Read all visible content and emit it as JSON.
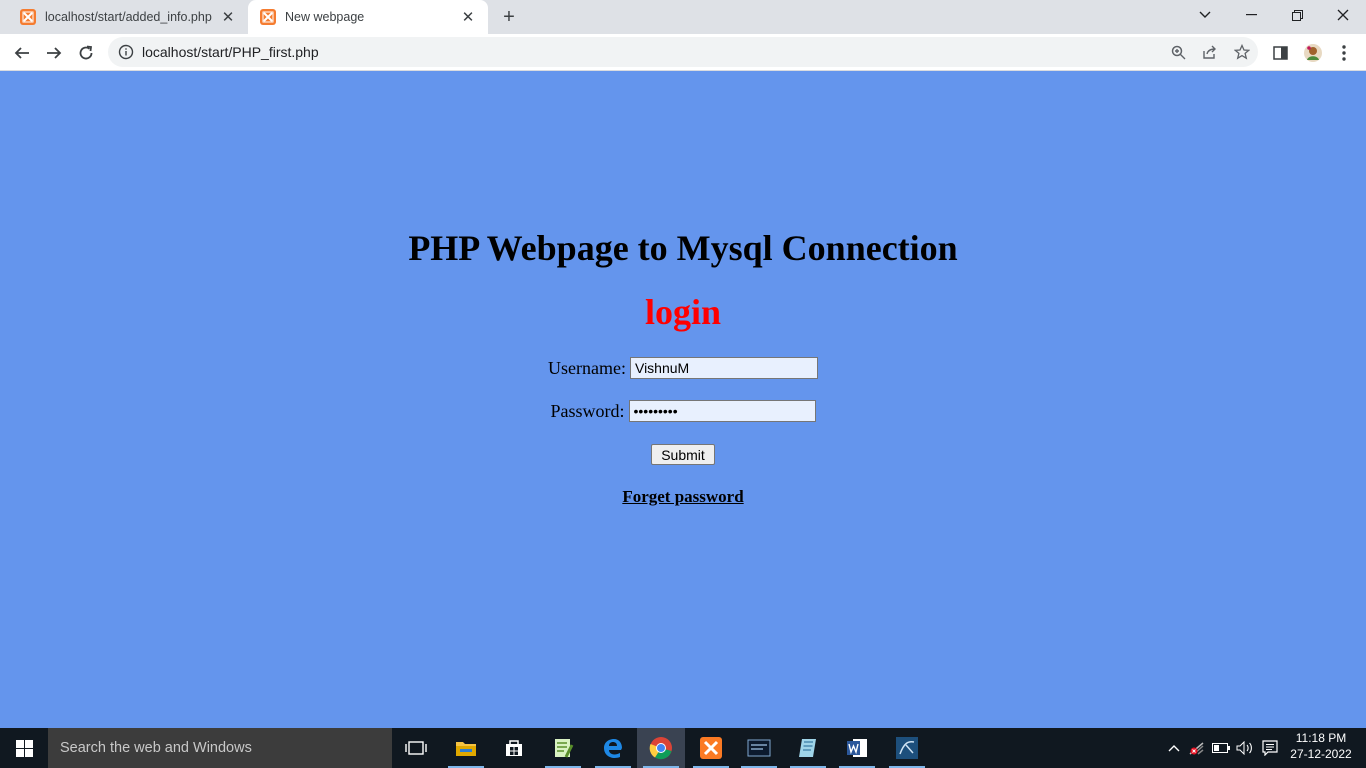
{
  "browser": {
    "tabs": [
      {
        "title": "localhost/start/added_info.php",
        "active": false
      },
      {
        "title": "New webpage",
        "active": true
      }
    ],
    "address": "localhost/start/PHP_first.php"
  },
  "page": {
    "heading": "PHP Webpage to Mysql Connection",
    "login_heading": "login",
    "username_label": "Username:",
    "username_value": "VishnuM",
    "password_label": "Password:",
    "password_value": "•••••••••",
    "submit_label": "Submit",
    "forget_link": "Forget password",
    "background_color": "#6495ED"
  },
  "taskbar": {
    "search_placeholder": "Search the web and Windows",
    "apps": [
      "task-view",
      "file-explorer",
      "store",
      "notepad-plus",
      "edge",
      "chrome",
      "xampp",
      "mysql-console",
      "editor",
      "word",
      "mysql-workbench"
    ],
    "clock_time": "11:18 PM",
    "clock_date": "27-12-2022"
  }
}
